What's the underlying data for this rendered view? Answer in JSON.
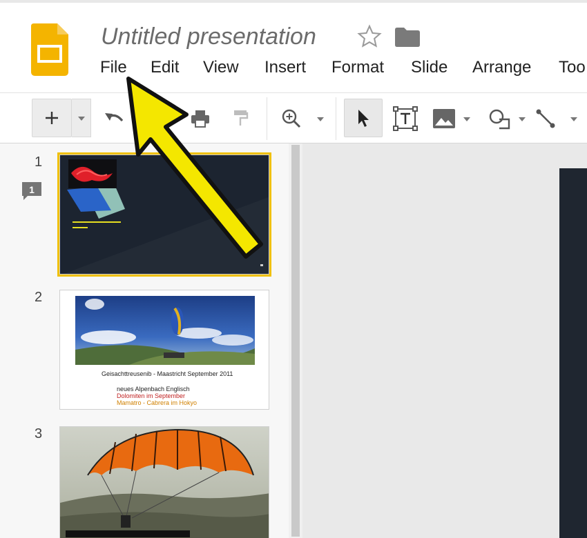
{
  "app": {
    "document_title": "Untitled presentation"
  },
  "menu": {
    "items": [
      "File",
      "Edit",
      "View",
      "Insert",
      "Format",
      "Slide",
      "Arrange",
      "Too"
    ]
  },
  "slides": [
    {
      "number": "1",
      "comment_count": "1"
    },
    {
      "number": "2",
      "caption_line1": "Geisachttreusenib - Maastricht September 2011",
      "caption_lines": [
        "neues Alpenbach Englisch",
        "Dolomiten im September",
        "Mamatro - Cabrera im Hokyo"
      ]
    },
    {
      "number": "3"
    }
  ],
  "colors": {
    "accent_yellow": "#f4e700",
    "slides_logo": "#f4b400",
    "slide_dark": "#1f2630"
  },
  "icons": {
    "logo": "google-slides-logo",
    "star": "star-icon",
    "folder": "folder-icon",
    "new_slide": "plus-icon",
    "undo": "undo-icon",
    "print": "print-icon",
    "paint_format": "paint-format-icon",
    "zoom": "zoom-icon",
    "select": "cursor-icon",
    "text_box": "text-box-icon",
    "image": "image-icon",
    "shape": "shape-icon",
    "line": "line-icon",
    "comment": "comment-icon",
    "annotation_arrow": "yellow-arrow"
  }
}
